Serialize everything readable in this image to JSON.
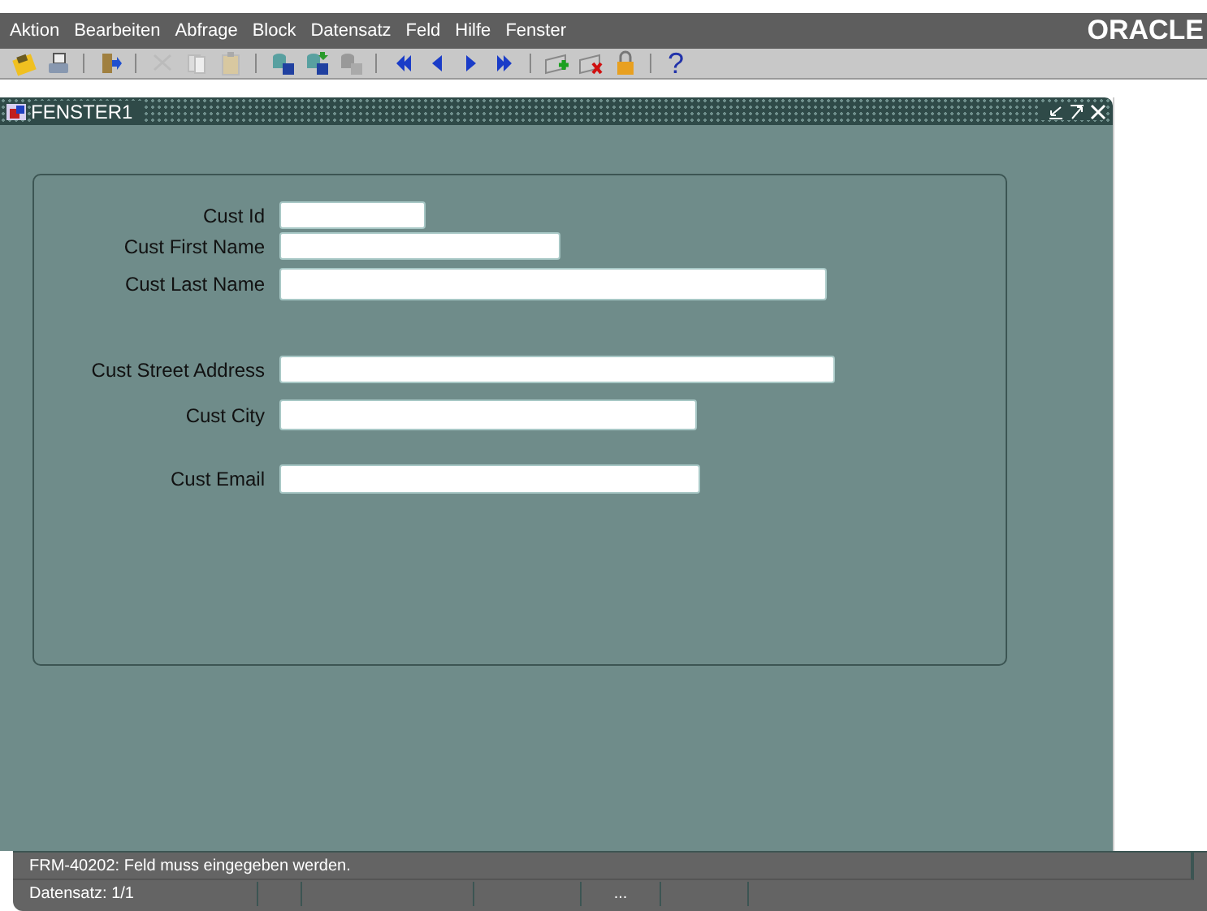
{
  "menu_bar": {
    "items": [
      "Aktion",
      "Bearbeiten",
      "Abfrage",
      "Block",
      "Datensatz",
      "Feld",
      "Hilfe",
      "Fenster"
    ],
    "logo": "ORACLE"
  },
  "toolbar": {
    "groups": [
      {
        "buttons": [
          {
            "kind": "save"
          },
          {
            "kind": "print"
          }
        ]
      },
      {
        "buttons": [
          {
            "kind": "exit"
          }
        ]
      },
      {
        "buttons": [
          {
            "kind": "cut"
          },
          {
            "kind": "copy"
          },
          {
            "kind": "paste"
          }
        ]
      },
      {
        "buttons": [
          {
            "kind": "query-enter"
          },
          {
            "kind": "query-execute"
          },
          {
            "kind": "query-cancel"
          }
        ]
      },
      {
        "buttons": [
          {
            "kind": "first"
          },
          {
            "kind": "previous"
          },
          {
            "kind": "next"
          },
          {
            "kind": "last"
          }
        ]
      },
      {
        "buttons": [
          {
            "kind": "insert"
          },
          {
            "kind": "delete"
          },
          {
            "kind": "lock"
          }
        ]
      },
      {
        "buttons": [
          {
            "kind": "help",
            "label": "?"
          }
        ]
      }
    ]
  },
  "window": {
    "title": "FENSTER1"
  },
  "form": {
    "fields": [
      {
        "label": "Cust Id"
      },
      {
        "label": "Cust First Name"
      },
      {
        "label": "Cust Last Name"
      },
      {
        "label": "Cust Street Address"
      },
      {
        "label": "Cust City"
      },
      {
        "label": "Cust Email"
      }
    ]
  },
  "status_bar": {
    "message": "FRM-40202: Feld muss eingegeben werden.",
    "record": "Datensatz: 1/1",
    "cells": [
      "",
      "",
      "",
      "...",
      "",
      ""
    ]
  }
}
